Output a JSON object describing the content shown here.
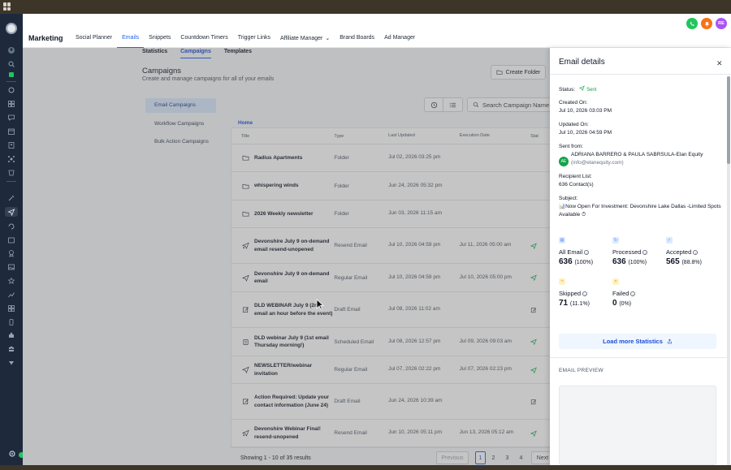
{
  "app": {
    "title": "Marketing"
  },
  "topnav": {
    "items": [
      "Social Planner",
      "Emails",
      "Snippets",
      "Countdown Timers",
      "Trigger Links",
      "Affiliate Manager",
      "Brand Boards",
      "Ad Manager"
    ],
    "active": "Emails"
  },
  "header": {
    "avatar_initials": "RE",
    "colors": {
      "phone": "#22c55e",
      "bell": "#f97316",
      "avatar": "#a855f7"
    }
  },
  "subtabs": {
    "items": [
      "Statistics",
      "Campaigns",
      "Templates"
    ],
    "active": "Campaigns"
  },
  "page": {
    "title": "Campaigns",
    "subtitle": "Create and manage campaigns for all of your emails",
    "create_folder": "Create Folder"
  },
  "leftnav": {
    "items": [
      "Email Campaigns",
      "Workflow Campaigns",
      "Bulk Action Campaigns"
    ],
    "active": "Email Campaigns"
  },
  "search": {
    "placeholder": "Search Campaign Name"
  },
  "breadcrumb": "Home",
  "table": {
    "columns": [
      "Title",
      "Type",
      "Last Updated",
      "Execution Date",
      "Stat"
    ],
    "rows": [
      {
        "icon": "folder-icon",
        "title": "Radius Apartments",
        "type": "Folder",
        "updated": "Jul 02, 2026 03:25 pm",
        "exec": "",
        "status_icon": ""
      },
      {
        "icon": "folder-icon",
        "title": "whispering winds",
        "type": "Folder",
        "updated": "Jun 24, 2026 05:32 pm",
        "exec": "",
        "status_icon": ""
      },
      {
        "icon": "folder-icon",
        "title": "2026 Weekly newsletter",
        "type": "Folder",
        "updated": "Jun 03, 2026 11:15 am",
        "exec": "",
        "status_icon": ""
      },
      {
        "icon": "resend-icon",
        "title": "Devonshire July 9 on-demand email resend-unopened",
        "type": "Resend Email",
        "updated": "Jul 10, 2026 04:59 pm",
        "exec": "Jul 11, 2026 05:00 am",
        "status_icon": "sent-icon"
      },
      {
        "icon": "send-icon",
        "title": "Devonshire July 9 on-demand email",
        "type": "Regular Email",
        "updated": "Jul 10, 2026 04:59 pm",
        "exec": "Jul 10, 2026 05:00 pm",
        "status_icon": "sent-icon"
      },
      {
        "icon": "draft-icon",
        "title": "DLD WEBINAR July 9 (2nd email an hour before the event)",
        "type": "Draft Email",
        "updated": "Jul 08, 2026 11:02 am",
        "exec": "",
        "status_icon": "draft-icon"
      },
      {
        "icon": "scheduled-icon",
        "title": "DLD webinar July 9 (1st email Thursday morning!)",
        "type": "Scheduled Email",
        "updated": "Jul 08, 2026 12:57 pm",
        "exec": "Jul 09, 2026 09:03 am",
        "status_icon": "sent-icon"
      },
      {
        "icon": "send-icon",
        "title": "NEWSLETTER/webinar invitation",
        "type": "Regular Email",
        "updated": "Jul 07, 2026 02:22 pm",
        "exec": "Jul 07, 2026 02:23 pm",
        "status_icon": "sent-icon"
      },
      {
        "icon": "draft-icon",
        "title": "Action Required: Update your contact information (June 24)",
        "type": "Draft Email",
        "updated": "Jun 24, 2026 10:39 am",
        "exec": "",
        "status_icon": "draft-icon"
      },
      {
        "icon": "resend-icon",
        "title": "Devonshire Webinar Final! resend-unopened",
        "type": "Resend Email",
        "updated": "Jun 10, 2026 05:11 pm",
        "exec": "Jun 13, 2026 05:12 am",
        "status_icon": "sent-icon"
      }
    ]
  },
  "pagination": {
    "showing": "Showing 1 - 10 of 35 results",
    "prev": "Previous",
    "pages": [
      "1",
      "2",
      "3",
      "4"
    ],
    "current": "1",
    "next": "Next"
  },
  "panel": {
    "title": "Email details",
    "status_label": "Status:",
    "status_value": "Sent",
    "created_label": "Created On:",
    "created_value": "Jul 10, 2026 03:03 PM",
    "updated_label": "Updated On:",
    "updated_value": "Jul 10, 2026 04:59 PM",
    "sent_from_label": "Sent from:",
    "sender_initials": "AE",
    "sender_name": "ADRIANA BARRERO & PAULA SABRSULA-Elan Equity",
    "sender_email": "(info@elanequity.com)",
    "recipient_label": "Recipient List:",
    "recipient_value": "636 Contact(s)",
    "subject_label": "Subject:",
    "subject_value": "📊Now Open For Investment: Devonshire Lake Dallas -Limited Spots Available ⏱",
    "stats": [
      {
        "label": "All Email",
        "count": "636",
        "pct": "(100%)",
        "color": "#3b82f6"
      },
      {
        "label": "Processed",
        "count": "636",
        "pct": "(100%)",
        "color": "#3b82f6"
      },
      {
        "label": "Accepted",
        "count": "565",
        "pct": "(88.8%)",
        "color": "#3b82f6"
      },
      {
        "label": "Skipped",
        "count": "71",
        "pct": "(11.1%)",
        "color": "#f59e0b"
      },
      {
        "label": "Failed",
        "count": "0",
        "pct": "(0%)",
        "color": "#f59e0b"
      }
    ],
    "load_more": "Load more Statistics",
    "preview_label": "EMAIL PREVIEW"
  }
}
